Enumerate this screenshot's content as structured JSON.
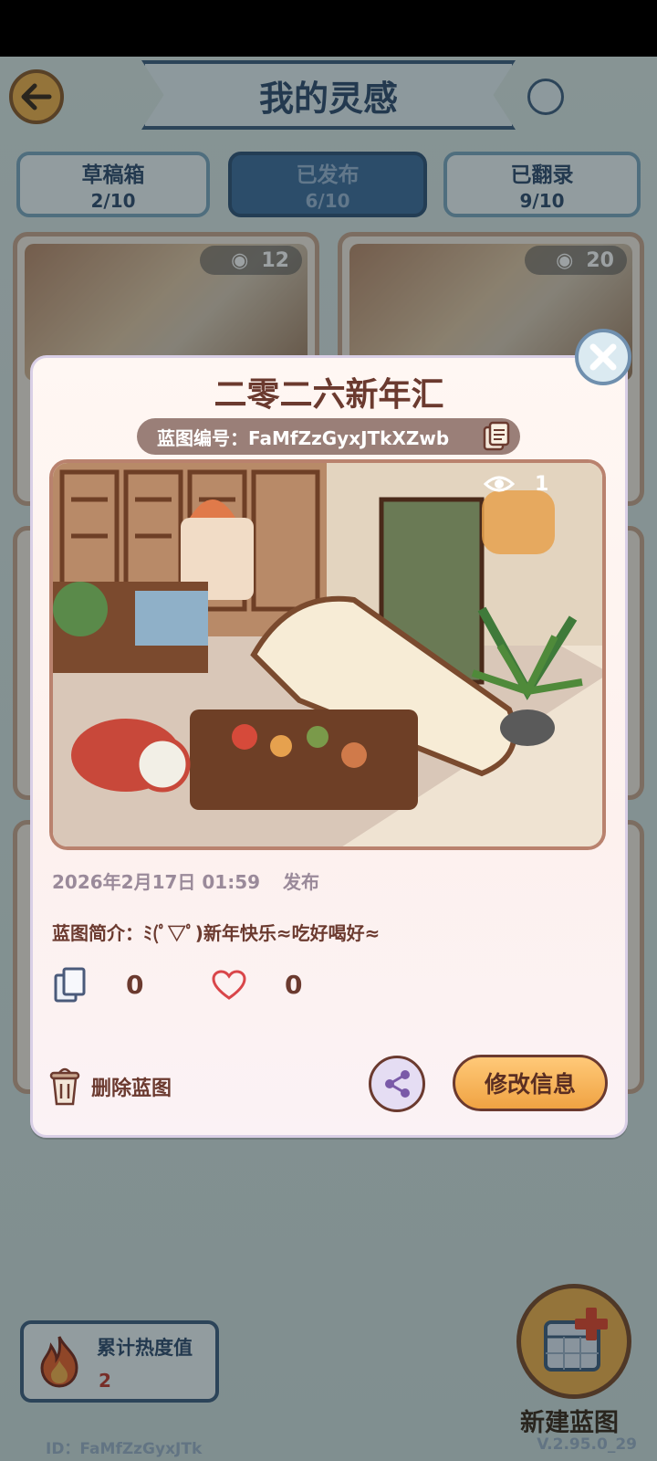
{
  "header": {
    "title": "我的灵感"
  },
  "tabs": [
    {
      "label": "草稿箱",
      "count": "2/10"
    },
    {
      "label": "已发布",
      "count": "6/10"
    },
    {
      "label": "已翻录",
      "count": "9/10"
    }
  ],
  "cards": [
    {
      "views": "12"
    },
    {
      "views": "20"
    }
  ],
  "footer": {
    "heat_label": "累计热度值",
    "heat_value": "2",
    "new_blueprint_label": "新建蓝图",
    "user_id": "ID：FaMfZzGyxJTk",
    "version": "V.2.95.0_29"
  },
  "modal": {
    "title": "二零二六新年汇",
    "blueprint_id": "蓝图编号：FaMfZzGyxJTkXZwb",
    "scene_views": "1",
    "date": "2026年2月17日 01:59",
    "status": "发布",
    "description": "蓝图简介：ﾐ(ﾟ▽ﾟ)新年快乐≈吃好喝好≈",
    "copy_count": "0",
    "like_count": "0",
    "delete_label": "删除蓝图",
    "edit_label": "修改信息"
  },
  "colors": {
    "accent_orange": "#f2b24b",
    "brown_text": "#6b3a2f",
    "blue_border": "#3f5f80"
  }
}
